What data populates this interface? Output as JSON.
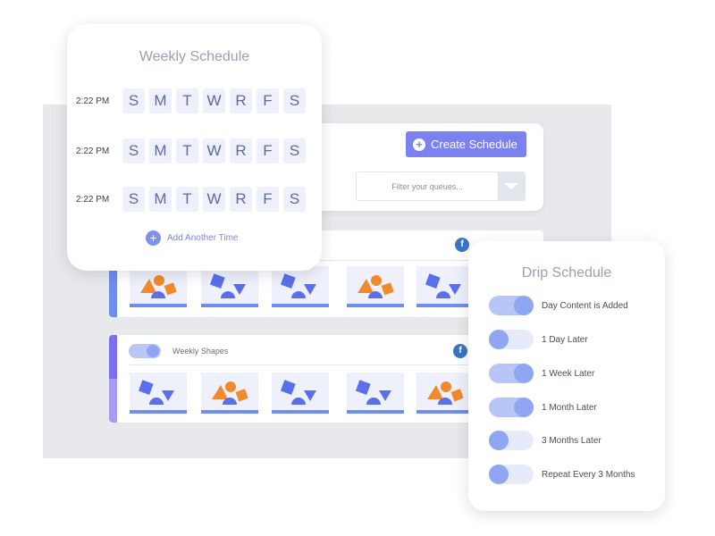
{
  "main": {
    "create_schedule_label": "Create Schedule",
    "filter_placeholder": "Filter your queues...",
    "queues": [
      {
        "title": "",
        "accent": "#6f8cf0"
      },
      {
        "title": "Weekly Shapes",
        "accent": "#8a7cf0"
      }
    ]
  },
  "weekly_schedule": {
    "title": "Weekly Schedule",
    "rows": [
      {
        "time": "2:22 PM",
        "days": [
          "S",
          "M",
          "T",
          "W",
          "R",
          "F",
          "S"
        ]
      },
      {
        "time": "2:22 PM",
        "days": [
          "S",
          "M",
          "T",
          "W",
          "R",
          "F",
          "S"
        ]
      },
      {
        "time": "2:22 PM",
        "days": [
          "S",
          "M",
          "T",
          "W",
          "R",
          "F",
          "S"
        ]
      }
    ],
    "add_time_label": "Add Another Time"
  },
  "drip_schedule": {
    "title": "Drip Schedule",
    "items": [
      {
        "label": "Day Content is Added",
        "enabled": true
      },
      {
        "label": "1 Day Later",
        "enabled": false
      },
      {
        "label": "1 Week Later",
        "enabled": true
      },
      {
        "label": "1 Month Later",
        "enabled": true
      },
      {
        "label": "3 Months Later",
        "enabled": false
      },
      {
        "label": "Repeat Every 3 Months",
        "enabled": false
      }
    ]
  },
  "colors": {
    "accent": "#7b82f0",
    "shape_orange": "#f08a2c",
    "shape_blue": "#5b6fe8"
  }
}
